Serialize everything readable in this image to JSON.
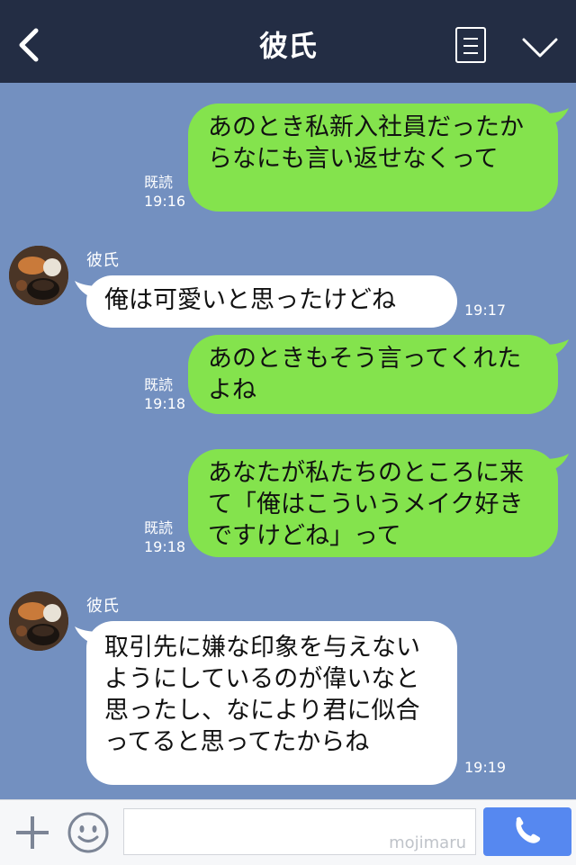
{
  "header": {
    "title": "彼氏"
  },
  "messages": [
    {
      "read": "既読",
      "time": "19:16",
      "text": "あのとき私新入社員だったからなにも言い返せなくって"
    },
    {
      "sender": "彼氏",
      "time": "19:17",
      "text": "俺は可愛いと思ったけどね"
    },
    {
      "read": "既読",
      "time": "19:18",
      "text": "あのときもそう言ってくれたよね"
    },
    {
      "read": "既読",
      "time": "19:18",
      "text": "あなたが私たちのところに来て「俺はこういうメイク好きですけどね」って"
    },
    {
      "sender": "彼氏",
      "time": "19:19",
      "text": "取引先に嫌な印象を与えないようにしているのが偉いなと思ったし、なにより君に似合ってると思ってたからね"
    }
  ],
  "input": {
    "watermark": "mojimaru"
  },
  "colors": {
    "background": "#7390c0",
    "header": "#232d44",
    "my_bubble": "#84e34d",
    "their_bubble": "#ffffff",
    "call_button": "#5688f0"
  }
}
